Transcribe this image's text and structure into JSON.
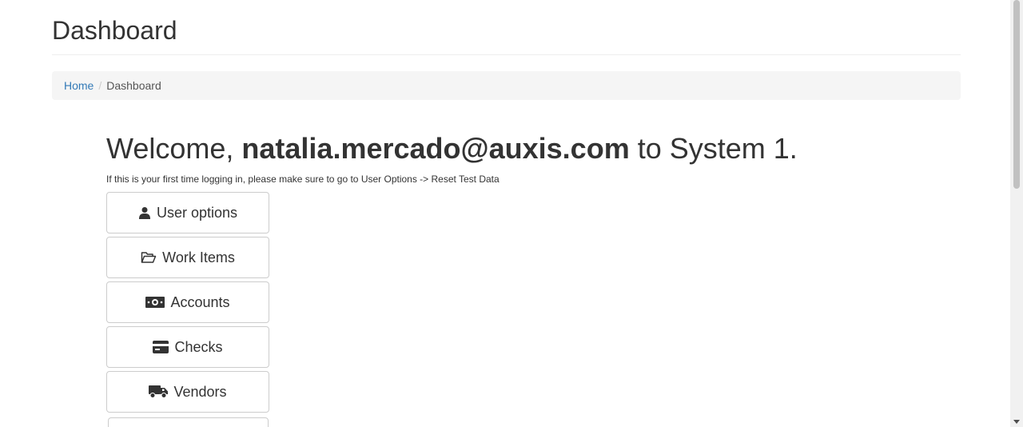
{
  "page": {
    "title": "Dashboard"
  },
  "breadcrumb": {
    "home": "Home",
    "separator": "/",
    "current": "Dashboard"
  },
  "welcome": {
    "prefix": "Welcome,",
    "user": "natalia.mercado@auxis.com",
    "suffix": "to System 1."
  },
  "hint": "If this is your first time logging in, please make sure to go to User Options -> Reset Test Data",
  "menu": [
    {
      "label": "User options",
      "icon": "user-icon"
    },
    {
      "label": "Work Items",
      "icon": "folder-open-icon"
    },
    {
      "label": "Accounts",
      "icon": "money-icon"
    },
    {
      "label": "Checks",
      "icon": "credit-card-icon"
    },
    {
      "label": "Vendors",
      "icon": "truck-icon"
    }
  ],
  "colors": {
    "link": "#337ab7",
    "breadcrumb_bg": "#f5f5f5",
    "button_border": "#cccccc"
  }
}
